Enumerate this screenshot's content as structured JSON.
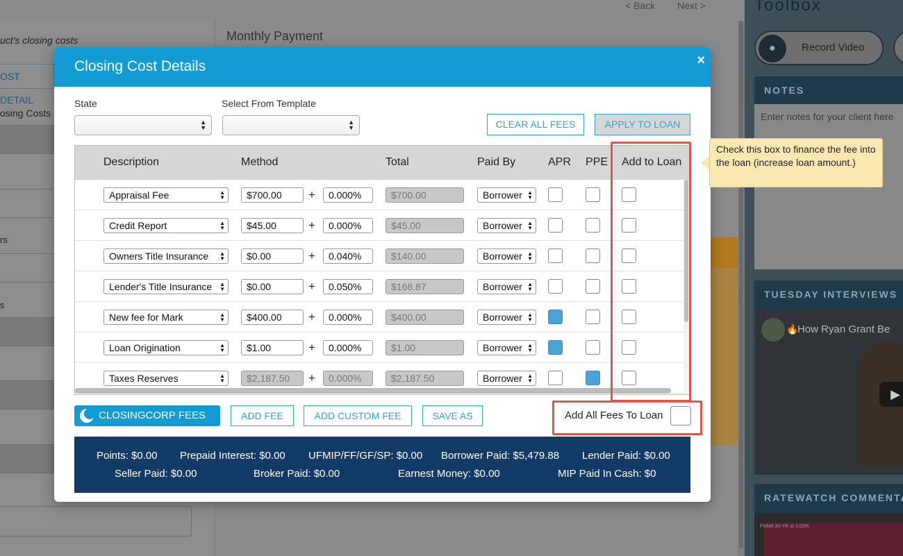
{
  "background": {
    "nav": {
      "back": "< Back",
      "next": "Next >"
    },
    "left": {
      "title": "uct's closing costs",
      "tab": "OST DETAIL",
      "closing": "osing Costs",
      "letters": [
        "rs",
        "s"
      ]
    },
    "monthly_payment": "Monthly Payment"
  },
  "toolbox": {
    "title": "Toolbox",
    "record_video": "Record Video",
    "notes": {
      "heading": "NOTES",
      "placeholder": "Enter notes for your client here"
    },
    "tuesday": {
      "heading": "TUESDAY INTERVIEWS",
      "video_title": "How Ryan Grant Be"
    },
    "ratewatch": {
      "heading": "RATEWATCH COMMENTA",
      "chart_label": "FNMA 30-YR at 3.00%"
    }
  },
  "modal": {
    "title": "Closing Cost Details",
    "close": "×",
    "state_label": "State",
    "template_label": "Select From Template",
    "clear_all_fees": "CLEAR ALL FEES",
    "apply_to_loan": "APPLY TO LOAN",
    "columns": {
      "description": "Description",
      "method": "Method",
      "total": "Total",
      "paid_by": "Paid By",
      "apr": "APR",
      "ppe": "PPE",
      "add_to_loan": "Add to Loan"
    },
    "fees": [
      {
        "description": "Appraisal Fee",
        "amount": "$700.00",
        "percent": "0.000%",
        "total": "$700.00",
        "paid_by": "Borrower",
        "apr": false,
        "ppe": false,
        "add_to_loan": false,
        "amount_disabled": false
      },
      {
        "description": "Credit Report",
        "amount": "$45.00",
        "percent": "0.000%",
        "total": "$45.00",
        "paid_by": "Borrower",
        "apr": false,
        "ppe": false,
        "add_to_loan": false,
        "amount_disabled": false
      },
      {
        "description": "Owners Title Insurance",
        "amount": "$0.00",
        "percent": "0.040%",
        "total": "$140.00",
        "paid_by": "Borrower",
        "apr": false,
        "ppe": false,
        "add_to_loan": false,
        "amount_disabled": false
      },
      {
        "description": "Lender's Title Insurance",
        "amount": "$0.00",
        "percent": "0.050%",
        "total": "$168.87",
        "paid_by": "Borrower",
        "apr": false,
        "ppe": false,
        "add_to_loan": false,
        "amount_disabled": false
      },
      {
        "description": "New fee for Mark",
        "amount": "$400.00",
        "percent": "0.000%",
        "total": "$400.00",
        "paid_by": "Borrower",
        "apr": true,
        "ppe": false,
        "add_to_loan": false,
        "amount_disabled": false
      },
      {
        "description": "Loan Origination",
        "amount": "$1.00",
        "percent": "0.000%",
        "total": "$1.00",
        "paid_by": "Borrower",
        "apr": true,
        "ppe": false,
        "add_to_loan": false,
        "amount_disabled": false
      },
      {
        "description": "Taxes Reserves",
        "amount": "$2,187.50",
        "percent": "0.000%",
        "total": "$2,187.50",
        "paid_by": "Borrower",
        "apr": false,
        "ppe": true,
        "add_to_loan": false,
        "amount_disabled": true
      }
    ],
    "plus": "+",
    "closingcorp_fees": "CLOSINGCORP FEES",
    "add_fee": "ADD FEE",
    "add_custom_fee": "ADD CUSTOM FEE",
    "save_as": "SAVE AS",
    "add_all_fees_to_loan": "Add All Fees To Loan",
    "summary": {
      "points": "Points: $0.00",
      "prepaid_interest": "Prepaid Interest: $0.00",
      "ufmip": "UFMIP/FF/GF/SP: $0.00",
      "borrower_paid": "Borrower Paid: $5,479.88",
      "lender_paid": "Lender Paid: $0.00",
      "seller_paid": "Seller Paid: $0.00",
      "broker_paid": "Broker Paid: $0.00",
      "earnest_money": "Earnest Money: $0.00",
      "mip_paid_in_cash": "MIP Paid In Cash: $0"
    }
  },
  "tooltip": {
    "text": "Check this box to finance the fee into the loan (increase loan amount.)"
  },
  "colors": {
    "primary": "#139cd3",
    "summary_bg": "#123a66",
    "highlight": "#e0574a",
    "checkbox_checked": "#4aa3d4"
  }
}
